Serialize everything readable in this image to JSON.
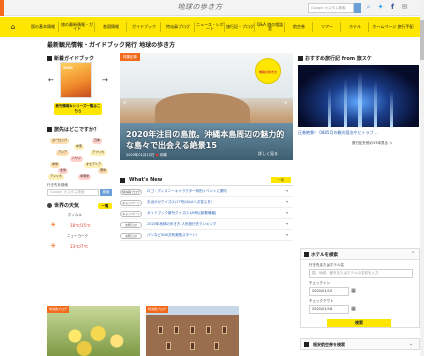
{
  "header": {
    "logo": "地球の歩き方",
    "search_placeholder": "Google カスタム検索",
    "sns": [
      "search-icon",
      "twitter-icon",
      "facebook-icon",
      "mail-icon"
    ]
  },
  "nav": [
    {
      "label": "国の基本情報"
    },
    {
      "label": "旅の最新情報・ガイド"
    },
    {
      "label": "各国情報"
    },
    {
      "label": "ガイドブック"
    },
    {
      "label": "特派員ブログ"
    },
    {
      "label": "ニュース・レポート"
    },
    {
      "label": "旅行記・ブログ"
    },
    {
      "label": "Q&A 旅の相談室"
    },
    {
      "label": "航空券"
    },
    {
      "label": "ツアー"
    },
    {
      "label": "ホテル"
    },
    {
      "label": "ホームページ 旅行手配"
    }
  ],
  "page_title": "最新観光情報・ガイドブック発行 地球の歩き方",
  "sidebar": {
    "guide_section": "新着ガイドブック",
    "guide_thumb": "2020",
    "guide_button": "新刊情報&シリーズ一覧はこちら",
    "dest_section": "旅先はどこですか？",
    "tags": [
      "ヨーロッパ",
      "日本",
      "中東",
      "アジア",
      "アフリカ",
      "ハワイ",
      "中米",
      "オセアニア",
      "北米",
      "南米",
      "アメリカ",
      "中南米"
    ],
    "search_label": "行き先を検索",
    "search_placeholder": "Google カスタム検索",
    "search_button": "検索",
    "weather_section": "世界の天気",
    "weather_button": "一覧",
    "weather": [
      {
        "city": "ホノルル",
        "temp": "18℃/15℃"
      },
      {
        "city": "ニューヨーク",
        "temp": "13℃/7℃"
      }
    ]
  },
  "hero": {
    "badge": "特集記事",
    "stamp": "地球の歩き方",
    "title": "2020年注目の島旅。沖縄本島周辺の魅力的な島々で出会える絶景15",
    "date": "2020年01月15日",
    "area": "沖縄",
    "more": "詳しく見る"
  },
  "whats_new": {
    "title": "What's New",
    "all": "一覧",
    "items": [
      {
        "cat": "特派員ブログ",
        "text": "ロゴ・ディスニーキャラクター特別イベントに関与"
      },
      {
        "cat": "キャンペーン",
        "text": "お出かけクイズ(1/17号)Q&Aへお答えを！"
      },
      {
        "cat": "キャンペーン",
        "text": "ガイドブック新刊クイズ(11/8号)[新着情報]"
      },
      {
        "cat": "お知らせ",
        "text": "2020年地球の歩き方 人気旅行先ランキング"
      },
      {
        "cat": "お知らせ",
        "text": "パリなどSNS共有実践スタート！"
      }
    ]
  },
  "right": {
    "title": "おすすめ旅行記 from 旅スケ",
    "caption": "圧巻絶景！ 0885月の観光宿泊やヒトラブ…",
    "more": "旅行記を他の33本見る ＞"
  },
  "hotel": {
    "title": "ホテルを検索",
    "dest_label": "行き先またはホテル名",
    "dest_placeholder": "国、地域、都市またはホテルの名前を入力",
    "checkin_label": "チェックイン",
    "checkin": "2020/01/15",
    "checkout_label": "チェックアウト",
    "checkout": "2020/01/16",
    "button": "検索"
  },
  "lower": {
    "title": "格安航空券を検索"
  },
  "cards": [
    {
      "badge": "特派員ブログ"
    },
    {
      "badge": "特派員ブログ"
    }
  ],
  "colors": {
    "accent": "#ffe600",
    "brand": "#f26b1d",
    "link": "#2a62b8"
  }
}
